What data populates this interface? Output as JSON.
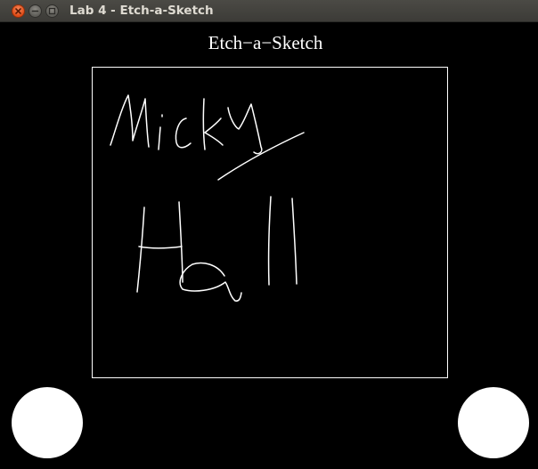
{
  "window": {
    "title": "Lab 4 - Etch-a-Sketch",
    "controls": [
      "close-icon",
      "minimize-icon",
      "maximize-icon"
    ],
    "close_color": "#df4a16"
  },
  "canvas": {
    "background": "#000000",
    "heading": "Etch−a−Sketch",
    "border_color": "#ffffff",
    "ink_color": "#ffffff",
    "knobs": [
      "left-knob",
      "right-knob"
    ]
  }
}
